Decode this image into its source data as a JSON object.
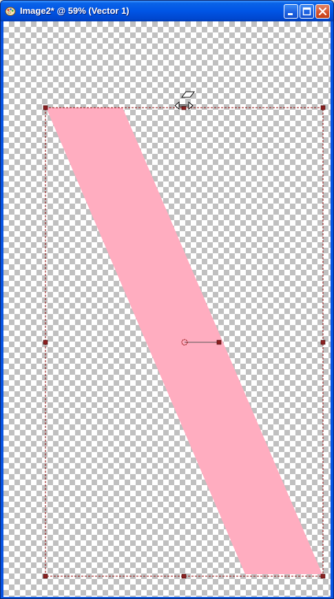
{
  "window": {
    "title": "Image2* @  59% (Vector 1)",
    "buttons": [
      "minimize",
      "maximize",
      "close"
    ],
    "icons": {
      "app": "paint-palette-icon",
      "minimize": "minimize-icon",
      "maximize": "maximize-icon",
      "close": "close-icon"
    }
  },
  "canvas": {
    "background": "transparency-checkerboard",
    "shape": {
      "type": "vector-parallelogram",
      "fill": "#ffadc0",
      "selected": true
    },
    "selection_color": "#8b0000",
    "cursor_icon": "shear-move-cursor-icon"
  }
}
